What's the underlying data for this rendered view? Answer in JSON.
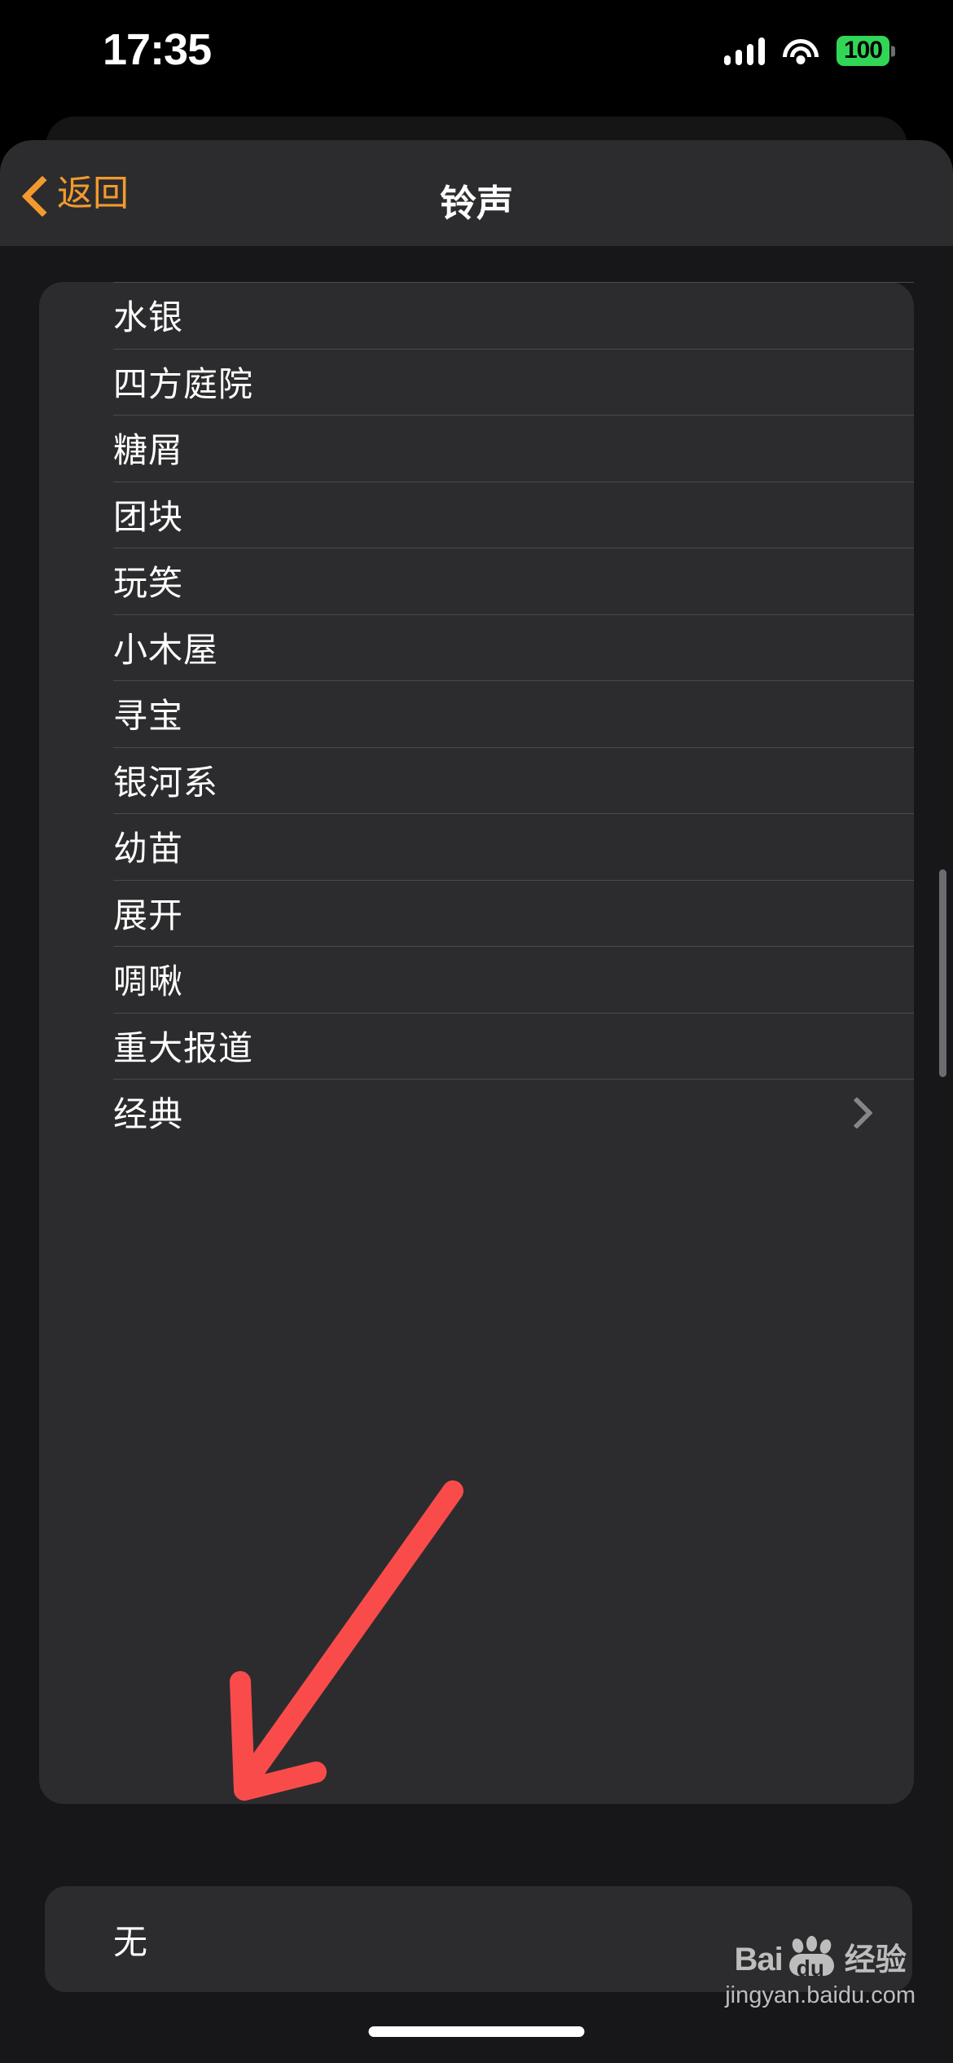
{
  "status_bar": {
    "time": "17:35",
    "battery_level": "100",
    "battery_color": "#32D657",
    "signal_icon": "cellular-signal-icon",
    "wifi_icon": "wifi-icon"
  },
  "nav": {
    "back_label": "返回",
    "back_icon": "chevron-left-icon",
    "title": "铃声",
    "accent_color": "#F29A2E"
  },
  "ringtone_list": [
    {
      "label": "水银",
      "chevron": false
    },
    {
      "label": "四方庭院",
      "chevron": false
    },
    {
      "label": "糖屑",
      "chevron": false
    },
    {
      "label": "团块",
      "chevron": false
    },
    {
      "label": "玩笑",
      "chevron": false
    },
    {
      "label": "小木屋",
      "chevron": false
    },
    {
      "label": "寻宝",
      "chevron": false
    },
    {
      "label": "银河系",
      "chevron": false
    },
    {
      "label": "幼苗",
      "chevron": false
    },
    {
      "label": "展开",
      "chevron": false
    },
    {
      "label": "啁啾",
      "chevron": false
    },
    {
      "label": "重大报道",
      "chevron": false
    },
    {
      "label": "经典",
      "chevron": true
    }
  ],
  "none_option": {
    "label": "无"
  },
  "annotation": {
    "arrow_color": "#FA4B4B",
    "arrow_icon": "red-arrow-pointing-to-none-option"
  },
  "watermark": {
    "brand_prefix": "Bai",
    "brand_inner": "du",
    "brand_suffix": "经验",
    "url": "jingyan.baidu.com",
    "paw_icon": "baidu-paw-icon"
  },
  "colors": {
    "sheet_bg": "#1c1c1e",
    "nav_bg": "#2c2c2e",
    "card_bg": "#2c2c2e",
    "page_bg": "#171719",
    "separator": "#4a4a4c",
    "text": "#ffffff",
    "chevron": "#86868a"
  }
}
